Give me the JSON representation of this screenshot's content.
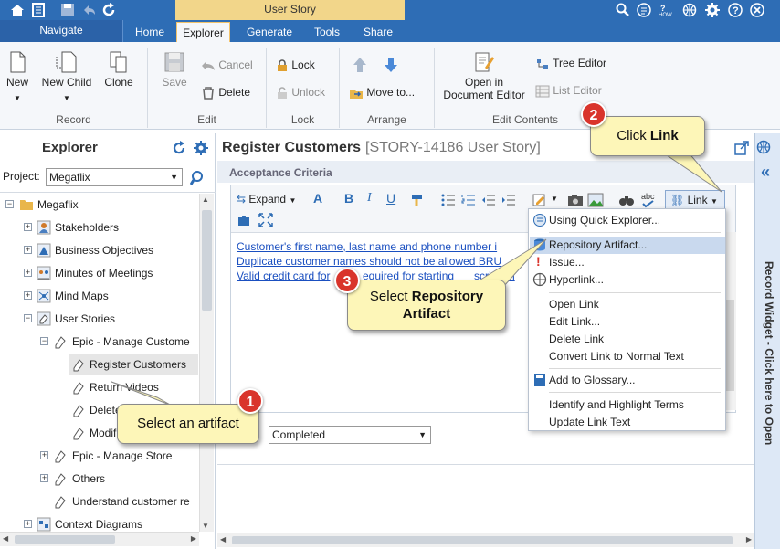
{
  "ribbon": {
    "context_header": "User Story",
    "tabs": [
      "Navigate",
      "Home",
      "Explorer",
      "Generate",
      "Tools",
      "Share"
    ],
    "new": "New",
    "new_child": "New Child",
    "clone": "Clone",
    "record_group": "Record",
    "save": "Save",
    "cancel": "Cancel",
    "delete": "Delete",
    "edit_group": "Edit",
    "lock": "Lock",
    "unlock": "Unlock",
    "lock_group": "Lock",
    "move_to": "Move to...",
    "arrange_group": "Arrange",
    "open_doc_editor_1": "Open in",
    "open_doc_editor_2": "Document Editor",
    "tree_editor": "Tree Editor",
    "list_editor": "List Editor",
    "edit_contents_group": "Edit Contents"
  },
  "explorer": {
    "title": "Explorer",
    "project_label": "Project:",
    "project_value": "Megaflix",
    "tree": [
      "Megaflix",
      "Stakeholders",
      "Business Objectives",
      "Minutes of Meetings",
      "Mind Maps",
      "User Stories",
      "Epic - Manage Custome",
      "Register Customers",
      "Return Videos",
      "Delete",
      "Modif",
      "Epic - Manage Store",
      "Others",
      "Understand customer re",
      "Context Diagrams"
    ]
  },
  "main": {
    "title": "Register Customers",
    "subtitle": "[STORY-14186 User Story]",
    "section": "Acceptance Criteria",
    "expand": "Expand",
    "link": "Link",
    "lines": [
      "Customer's first name, last name and phone number i",
      "Duplicate customer names should not be allowed",
      "Valid credit card for",
      "equired for starting",
      "scription"
    ],
    "line2_tail": "BRU",
    "status_value": "Completed"
  },
  "link_menu": {
    "items": [
      "Using Quick Explorer...",
      "Repository Artifact...",
      "Issue...",
      "Hyperlink...",
      "Open Link",
      "Edit Link...",
      "Delete Link",
      "Convert Link to Normal Text",
      "Add to Glossary...",
      "Identify and Highlight Terms",
      "Update Link Text"
    ]
  },
  "callouts": {
    "c1_num": "1",
    "c1_text": "Select an artifact",
    "c2_num": "2",
    "c2_text_pre": "Click ",
    "c2_text_bold": "Link",
    "c3_num": "3",
    "c3_text_pre": "Select ",
    "c3_text_bold1": "Repository",
    "c3_text_bold2": "Artifact"
  },
  "sidebar": {
    "text": "Record Widget - Click here to Open"
  },
  "colors": {
    "accent": "#2e6db5",
    "context": "#f2d68a",
    "callout": "#fdf6b8",
    "badge": "#d9342b",
    "link": "#1a4fc0",
    "highlight": "#c9d9ee"
  }
}
